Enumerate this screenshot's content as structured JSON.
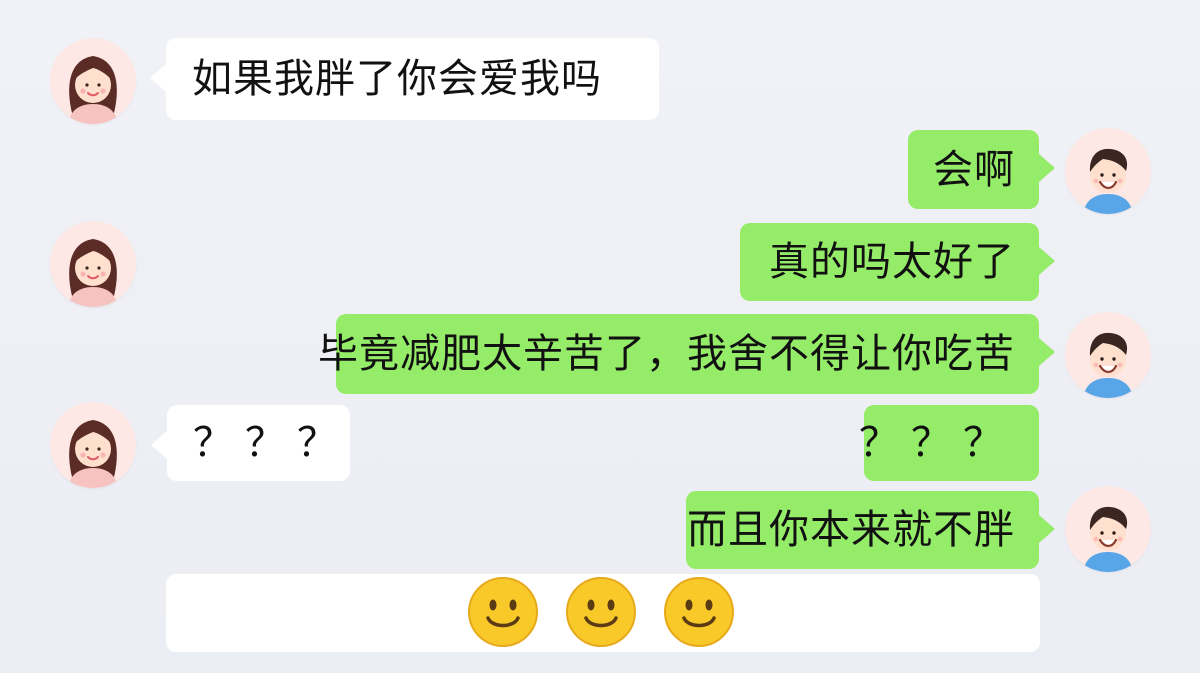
{
  "messages": [
    {
      "id": "m1",
      "side": "left",
      "text": "如果我胖了你会爱我吗"
    },
    {
      "id": "m2",
      "side": "right",
      "text": "会啊"
    },
    {
      "id": "m3",
      "side": "right",
      "text": "真的吗太好了"
    },
    {
      "id": "m4",
      "side": "right",
      "text": "毕竟减肥太辛苦了，我舍不得让你吃苦"
    },
    {
      "id": "m5",
      "side": "left",
      "text": "？？？"
    },
    {
      "id": "m6",
      "side": "right",
      "text": "？？？"
    },
    {
      "id": "m7",
      "side": "right",
      "text": "而且你本来就不胖"
    },
    {
      "id": "m8",
      "side": "left",
      "text": ""
    }
  ],
  "emoji": [
    "smiley-emoji",
    "smiley-emoji",
    "smiley-emoji"
  ],
  "avatars": {
    "female": "girl-avatar-icon",
    "male": "boy-avatar-icon"
  },
  "colors": {
    "background": "#eef0f6",
    "bubble_left": "#ffffff",
    "bubble_right": "#95ec69",
    "text": "#111111",
    "emoji_yellow": "#f8c928",
    "avatar_bg": "#fde8e6"
  }
}
